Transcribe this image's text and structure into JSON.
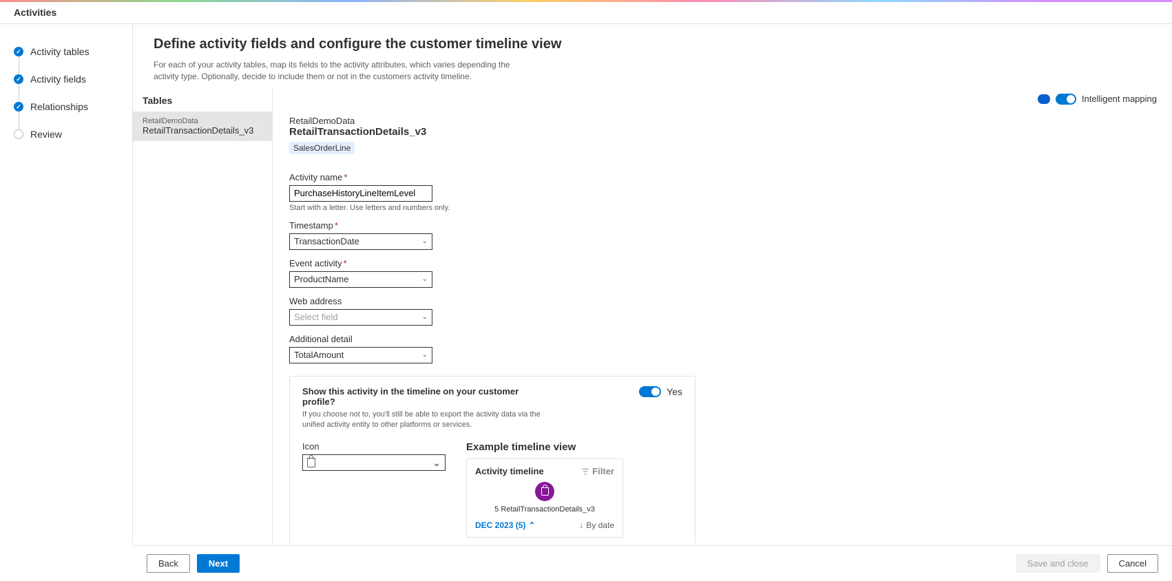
{
  "header": {
    "title": "Activities"
  },
  "steps": [
    {
      "label": "Activity tables",
      "state": "done"
    },
    {
      "label": "Activity fields",
      "state": "done"
    },
    {
      "label": "Relationships",
      "state": "done"
    },
    {
      "label": "Review",
      "state": "pending"
    }
  ],
  "page": {
    "title": "Define activity fields and configure the customer timeline view",
    "subtitle": "For each of your activity tables, map its fields to the activity attributes, which varies depending the activity type. Optionally, decide to include them or not in the customers activity timeline."
  },
  "tables": {
    "header": "Tables",
    "items": [
      {
        "source": "RetailDemoData",
        "name": "RetailTransactionDetails_v3"
      }
    ]
  },
  "intelligent": {
    "label": "Intelligent mapping",
    "on": true
  },
  "detail": {
    "source": "RetailDemoData",
    "table": "RetailTransactionDetails_v3",
    "entity_pill": "SalesOrderLine"
  },
  "form": {
    "activity_name": {
      "label": "Activity name",
      "value": "PurchaseHistoryLineItemLevel",
      "helper": "Start with a letter. Use letters and numbers only."
    },
    "timestamp": {
      "label": "Timestamp",
      "value": "TransactionDate"
    },
    "event_activity": {
      "label": "Event activity",
      "value": "ProductName"
    },
    "web_address": {
      "label": "Web address",
      "value": "",
      "placeholder": "Select field"
    },
    "additional_detail": {
      "label": "Additional detail",
      "value": "TotalAmount"
    }
  },
  "timeline": {
    "title": "Show this activity in the timeline on your customer profile?",
    "subtitle": "If you choose not to, you'll still be able to export the activity data via the unified activity entity to other platforms or services.",
    "yes_label": "Yes",
    "icon_label": "Icon",
    "icon_value": "shopping-bag",
    "preview_title": "Example timeline view",
    "preview": {
      "header": "Activity timeline",
      "filter": "Filter",
      "summary_count": "5",
      "summary_table": "RetailTransactionDetails_v3",
      "month_label": "DEC 2023 (5)",
      "bydate": "By date"
    }
  },
  "footer": {
    "back": "Back",
    "next": "Next",
    "save": "Save and close",
    "cancel": "Cancel"
  }
}
